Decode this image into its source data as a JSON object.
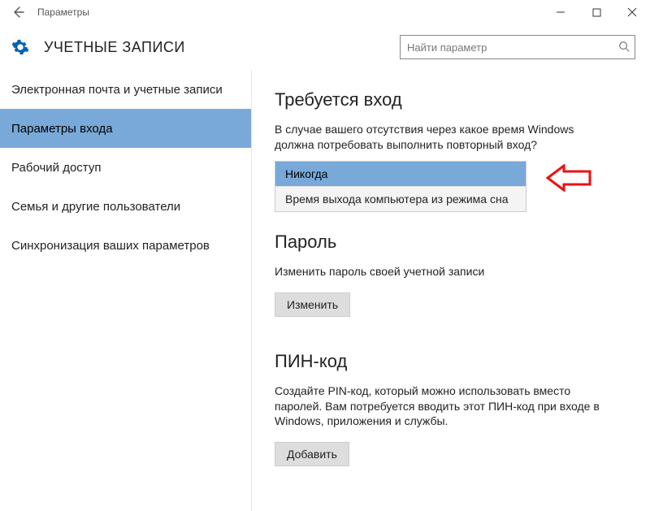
{
  "window": {
    "title": "Параметры"
  },
  "header": {
    "page_title": "УЧЕТНЫЕ ЗАПИСИ",
    "search_placeholder": "Найти параметр"
  },
  "sidebar": {
    "items": [
      {
        "label": "Электронная почта и учетные записи",
        "selected": false
      },
      {
        "label": "Параметры входа",
        "selected": true
      },
      {
        "label": "Рабочий доступ",
        "selected": false
      },
      {
        "label": "Семья и другие пользователи",
        "selected": false
      },
      {
        "label": "Синхронизация ваших параметров",
        "selected": false
      }
    ]
  },
  "content": {
    "signin": {
      "heading": "Требуется вход",
      "desc": "В случае вашего отсутствия через какое время Windows должна потребовать выполнить повторный вход?",
      "options": [
        "Никогда",
        "Время выхода компьютера из режима сна"
      ],
      "selected_index": 0
    },
    "password": {
      "heading": "Пароль",
      "desc": "Изменить пароль своей учетной записи",
      "button": "Изменить"
    },
    "pin": {
      "heading": "ПИН-код",
      "desc": "Создайте PIN-код, который можно использовать вместо паролей. Вам потребуется вводить этот ПИН-код при входе в Windows, приложения и службы.",
      "button": "Добавить"
    }
  }
}
